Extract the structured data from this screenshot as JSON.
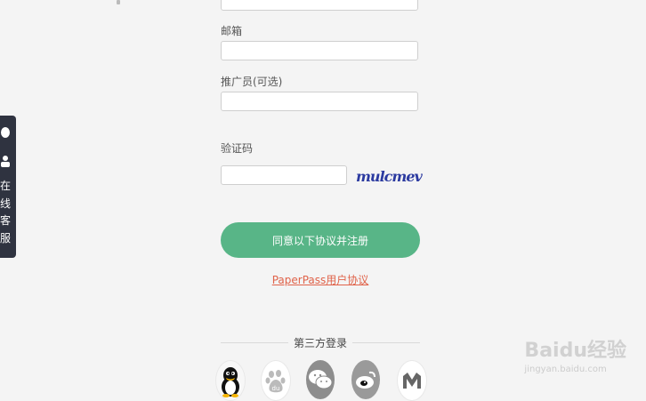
{
  "form": {
    "email_label": "邮箱",
    "promoter_label": "推广员(可选)",
    "captcha_label": "验证码",
    "captcha_text": "mulcmev",
    "submit_label": "同意以下协议并注册",
    "agreement_link": "PaperPass用户协议"
  },
  "third_party": {
    "title": "第三方登录",
    "providers": [
      "qq-icon",
      "baidu-icon",
      "wechat-icon",
      "weibo-icon",
      "other-icon"
    ]
  },
  "side_panel": {
    "text": "在线客服"
  },
  "watermark": {
    "main": "Baidu经验",
    "sub": "jingyan.baidu.com"
  }
}
